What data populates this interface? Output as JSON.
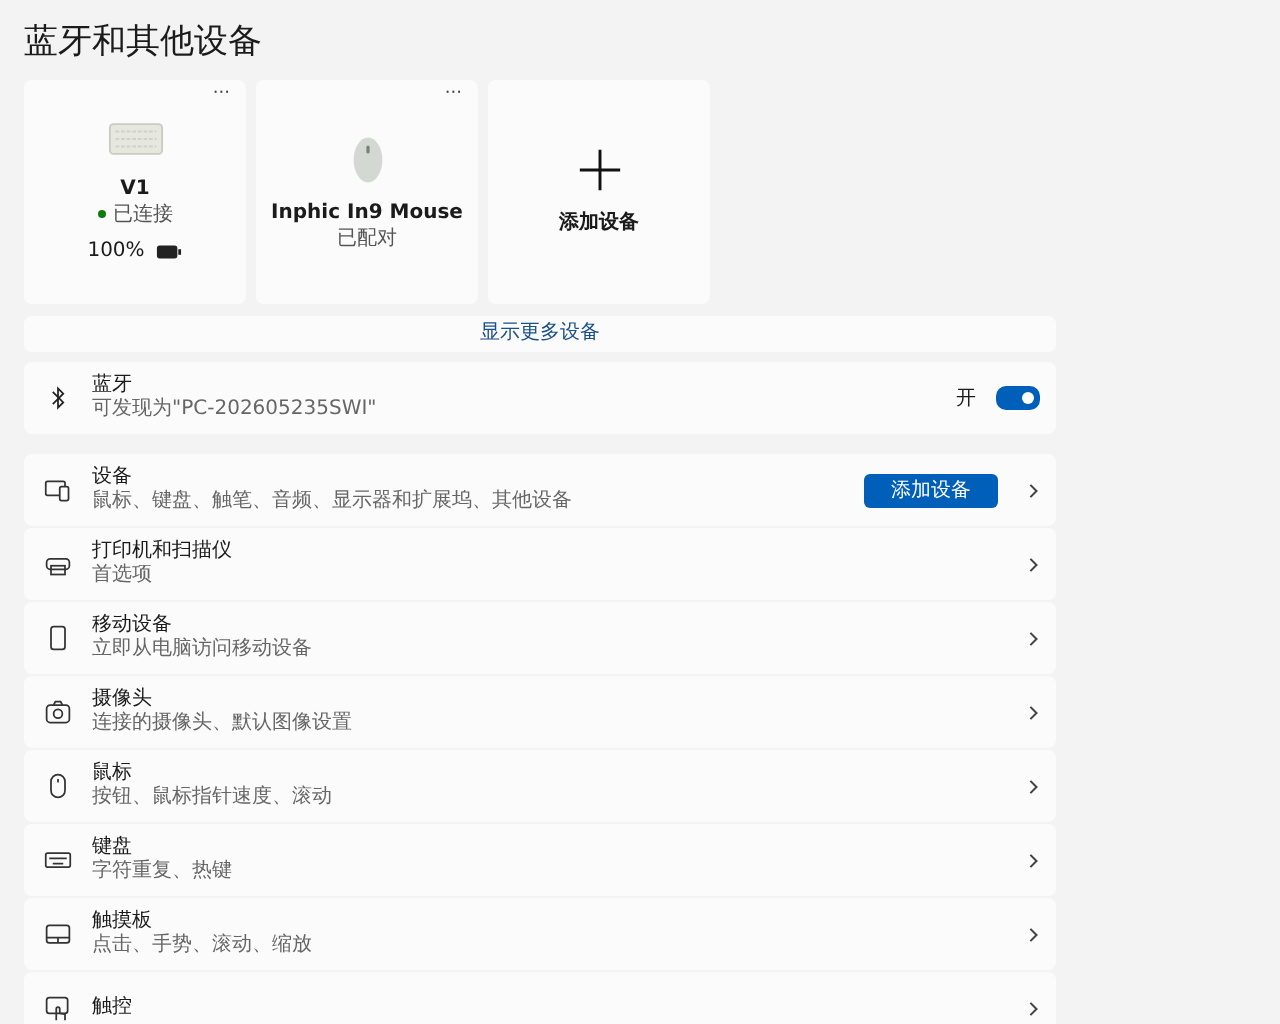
{
  "title": "蓝牙和其他设备",
  "device_cards": [
    {
      "kind": "keyboard",
      "name": "V1",
      "status": "已连接",
      "connected": true,
      "battery": "100%",
      "menu": "···"
    },
    {
      "kind": "mouse",
      "name": "Inphic In9 Mouse",
      "status": "已配对",
      "menu": "···"
    },
    {
      "kind": "add",
      "name": "添加设备"
    }
  ],
  "show_more": "显示更多设备",
  "bluetooth": {
    "title": "蓝牙",
    "subtitle": "可发现为\"PC-202605235SWI\"",
    "state_label": "开",
    "on": true
  },
  "rows": [
    {
      "kind": "devices",
      "title": "设备",
      "subtitle": "鼠标、键盘、触笔、音频、显示器和扩展坞、其他设备",
      "button": "添加设备"
    },
    {
      "kind": "printer",
      "title": "打印机和扫描仪",
      "subtitle": "首选项"
    },
    {
      "kind": "phone",
      "title": "移动设备",
      "subtitle": "立即从电脑访问移动设备"
    },
    {
      "kind": "camera",
      "title": "摄像头",
      "subtitle": "连接的摄像头、默认图像设置"
    },
    {
      "kind": "mouse",
      "title": "鼠标",
      "subtitle": "按钮、鼠标指针速度、滚动"
    },
    {
      "kind": "keyboard",
      "title": "键盘",
      "subtitle": "字符重复、热键"
    },
    {
      "kind": "touchpad",
      "title": "触摸板",
      "subtitle": "点击、手势、滚动、缩放"
    },
    {
      "kind": "touch",
      "title": "触控"
    }
  ]
}
